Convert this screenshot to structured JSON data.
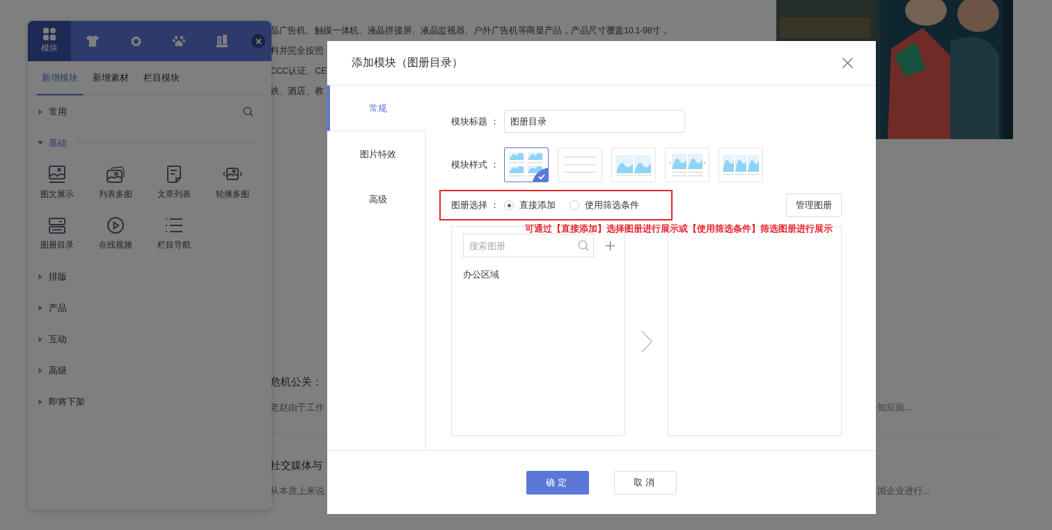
{
  "page": {
    "paragraph_lines": [
      "晶广告机、触摸一体机、液晶拼接屏、液晶监视器、户外广告机等商显产品，产品尺寸覆盖10.1-98寸，",
      "料并完全按照",
      "CCC认证、CE",
      "铁、酒店、教"
    ],
    "photo": {
      "kind": "picture"
    },
    "articles": [
      {
        "title": "危机公关：",
        "excerpt": "老赵由于工作",
        "excerpt_end": "知层面..."
      },
      {
        "title": "社交媒体与",
        "excerpt": "从本质上来说",
        "excerpt_end": "国企业进行..."
      }
    ]
  },
  "panel": {
    "top_tabs": [
      {
        "kind": "grid",
        "label": "模块",
        "selected": true
      },
      {
        "kind": "shirt",
        "selected": false
      },
      {
        "kind": "gear",
        "selected": false
      },
      {
        "kind": "paw",
        "selected": false
      },
      {
        "kind": "building",
        "selected": false
      }
    ],
    "sub_tabs": [
      {
        "label": "新增模块",
        "selected": true
      },
      {
        "label": "新增素材",
        "selected": false
      },
      {
        "label": "栏目模块",
        "selected": false
      }
    ],
    "sections": [
      {
        "label": "常用",
        "expanded": false
      },
      {
        "label": "基础",
        "expanded": true,
        "items": [
          {
            "kind": "image-text",
            "label": "图文展示"
          },
          {
            "kind": "stacked",
            "label": "列表多图"
          },
          {
            "kind": "article",
            "label": "文章列表"
          },
          {
            "kind": "carousel",
            "label": "轮播多图"
          },
          {
            "kind": "album",
            "label": "图册目录"
          },
          {
            "kind": "video",
            "label": "在线视频"
          },
          {
            "kind": "nav",
            "label": "栏目导航"
          }
        ]
      },
      {
        "label": "排版",
        "expanded": false
      },
      {
        "label": "产品",
        "expanded": false
      },
      {
        "label": "互动",
        "expanded": false
      },
      {
        "label": "高级",
        "expanded": false
      },
      {
        "label": "即将下架",
        "expanded": false
      }
    ]
  },
  "dialog": {
    "title": "添加模块（图册目录）",
    "nav": [
      {
        "label": "常规",
        "selected": true
      },
      {
        "label": "图片特效",
        "selected": false
      },
      {
        "label": "高级",
        "selected": false
      }
    ],
    "title_label": "模块标题 ：",
    "title_value": "图册目录",
    "style_label": "模块样式 ：",
    "styles": [
      {
        "kind": "grid",
        "selected": true
      },
      {
        "kind": "list",
        "selected": false
      },
      {
        "kind": "two",
        "selected": false
      },
      {
        "kind": "carousel",
        "selected": false
      },
      {
        "kind": "three",
        "selected": false
      }
    ],
    "album_label": "图册选择 ：",
    "album_options": [
      {
        "label": "直接添加",
        "selected": true
      },
      {
        "label": "使用筛选条件",
        "selected": false
      }
    ],
    "manage_button": "管理图册",
    "hint": "可通过【直接添加】选择图册进行展示或【使用筛选条件】筛选图册进行展示",
    "search_placeholder": "搜索图册",
    "albums": [
      "办公区域"
    ],
    "buttons": [
      {
        "kind": "primary",
        "label": "确定"
      },
      {
        "kind": "default",
        "label": "取消"
      }
    ]
  }
}
